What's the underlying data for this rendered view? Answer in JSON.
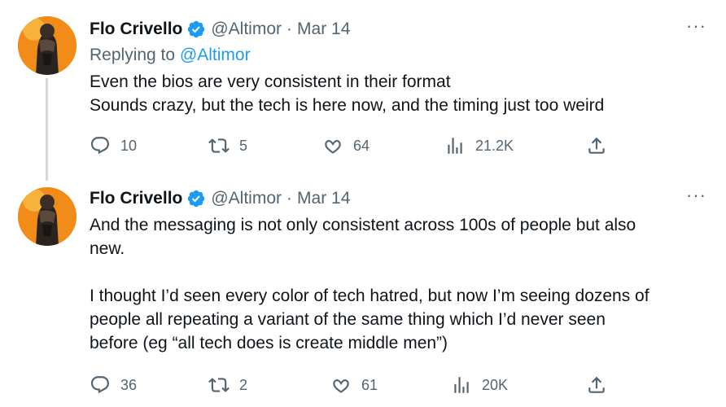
{
  "tweets": [
    {
      "author": {
        "name": "Flo Crivello",
        "handle": "@Altimor"
      },
      "separator": "·",
      "date": "Mar 14",
      "more": "···",
      "replying_prefix": "Replying to",
      "replying_handle": "@Altimor",
      "lines": [
        "Even the bios are very consistent in their format",
        "Sounds crazy, but the tech is here now, and the timing just too weird"
      ],
      "stats": {
        "replies": "10",
        "retweets": "5",
        "likes": "64",
        "views": "21.2K"
      }
    },
    {
      "author": {
        "name": "Flo Crivello",
        "handle": "@Altimor"
      },
      "separator": "·",
      "date": "Mar 14",
      "more": "···",
      "paragraphs": [
        [
          "And the messaging is not only consistent across 100s of people but also",
          "new."
        ],
        [
          "I thought I’d seen every color of tech hatred, but now I’m seeing dozens of",
          "people all repeating a variant of the same thing which I’d never seen",
          "before (eg “all tech does is create middle men”)"
        ]
      ],
      "stats": {
        "replies": "36",
        "retweets": "2",
        "likes": "61",
        "views": "20K"
      }
    }
  ],
  "colors": {
    "accent": "#1d9bf0",
    "muted": "#536471",
    "text": "#0f1419",
    "thread": "#cfd9de"
  }
}
